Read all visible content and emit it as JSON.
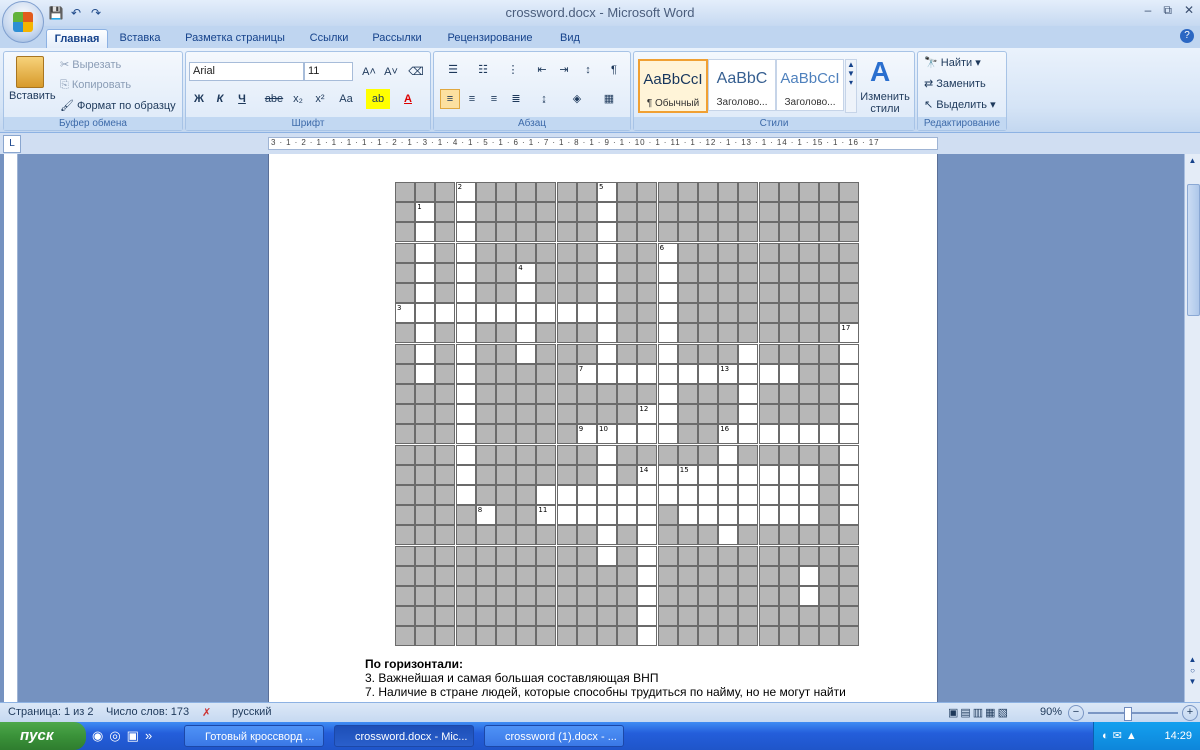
{
  "window": {
    "title": "crossword.docx - Microsoft Word"
  },
  "qat": {
    "save": "💾",
    "undo": "↶",
    "redo": "↷"
  },
  "window_controls": {
    "minimize": "–",
    "restore": "⧉",
    "close": "✕"
  },
  "tabs": [
    "Главная",
    "Вставка",
    "Разметка страницы",
    "Ссылки",
    "Рассылки",
    "Рецензирование",
    "Вид"
  ],
  "help": "?",
  "clipboard": {
    "paste": "Вставить",
    "cut": "Вырезать",
    "copy": "Копировать",
    "format_painter": "Формат по образцу",
    "label": "Буфер обмена"
  },
  "font": {
    "name": "Arial",
    "size": "11",
    "label": "Шрифт",
    "bold": "Ж",
    "italic": "К",
    "underline": "Ч",
    "strike": "abe",
    "sub": "x₂",
    "sup": "x²",
    "case": "Aa",
    "grow": "A˄",
    "shrink": "A˅"
  },
  "paragraph": {
    "label": "Абзац"
  },
  "styles": {
    "label": "Стили",
    "items": [
      {
        "preview": "AaBbCcI",
        "name": "¶ Обычный"
      },
      {
        "preview": "AaBbC",
        "name": "Заголово..."
      },
      {
        "preview": "AaBbCcI",
        "name": "Заголово..."
      }
    ],
    "change": "Изменить стили"
  },
  "editing": {
    "find": "Найти",
    "replace": "Заменить",
    "select": "Выделить",
    "label": "Редактирование"
  },
  "ruler": {
    "ticks": "3 · 1 · 2 · 1 · 1 · 1 · 1 · 1 · 2 · 1 · 3 · 1 · 4 · 1 · 5 · 1 · 6 · 1 · 7 · 1 · 8 · 1 · 9 · 1 · 10 · 1 · 11 · 1 · 12 · 1 · 13 · 1 · 14 · 1 · 15 · 1 · 16 · 17"
  },
  "crossword": {
    "rows": 23,
    "cols": 23,
    "white_cells": [
      [
        1,
        1
      ],
      [
        2,
        1
      ],
      [
        3,
        1
      ],
      [
        4,
        1
      ],
      [
        5,
        1
      ],
      [
        6,
        1
      ],
      [
        7,
        1
      ],
      [
        8,
        1
      ],
      [
        9,
        1
      ],
      [
        0,
        3
      ],
      [
        1,
        3
      ],
      [
        2,
        3
      ],
      [
        3,
        3
      ],
      [
        4,
        3
      ],
      [
        5,
        3
      ],
      [
        6,
        3
      ],
      [
        7,
        3
      ],
      [
        8,
        3
      ],
      [
        9,
        3
      ],
      [
        10,
        3
      ],
      [
        11,
        3
      ],
      [
        12,
        3
      ],
      [
        13,
        3
      ],
      [
        14,
        3
      ],
      [
        15,
        3
      ],
      [
        0,
        10
      ],
      [
        1,
        10
      ],
      [
        2,
        10
      ],
      [
        3,
        10
      ],
      [
        4,
        10
      ],
      [
        5,
        10
      ],
      [
        6,
        10
      ],
      [
        7,
        10
      ],
      [
        8,
        10
      ],
      [
        9,
        10
      ],
      [
        4,
        6
      ],
      [
        5,
        6
      ],
      [
        6,
        6
      ],
      [
        7,
        6
      ],
      [
        8,
        6
      ],
      [
        3,
        13
      ],
      [
        4,
        13
      ],
      [
        5,
        13
      ],
      [
        6,
        13
      ],
      [
        7,
        13
      ],
      [
        8,
        13
      ],
      [
        9,
        13
      ],
      [
        10,
        13
      ],
      [
        11,
        13
      ],
      [
        6,
        0
      ],
      [
        6,
        2
      ],
      [
        6,
        4
      ],
      [
        6,
        5
      ],
      [
        6,
        7
      ],
      [
        6,
        8
      ],
      [
        6,
        9
      ],
      [
        9,
        9
      ],
      [
        9,
        11
      ],
      [
        9,
        12
      ],
      [
        9,
        14
      ],
      [
        9,
        15
      ],
      [
        9,
        16
      ],
      [
        9,
        17
      ],
      [
        9,
        18
      ],
      [
        9,
        19
      ],
      [
        12,
        9
      ],
      [
        12,
        10
      ],
      [
        12,
        11
      ],
      [
        12,
        12
      ],
      [
        12,
        13
      ],
      [
        11,
        12
      ],
      [
        13,
        10
      ],
      [
        14,
        10
      ],
      [
        15,
        10
      ],
      [
        16,
        10
      ],
      [
        17,
        10
      ],
      [
        18,
        10
      ],
      [
        12,
        16
      ],
      [
        13,
        16
      ],
      [
        14,
        16
      ],
      [
        15,
        16
      ],
      [
        16,
        16
      ],
      [
        17,
        16
      ],
      [
        12,
        17
      ],
      [
        12,
        18
      ],
      [
        12,
        19
      ],
      [
        12,
        20
      ],
      [
        12,
        21
      ],
      [
        12,
        22
      ],
      [
        7,
        22
      ],
      [
        8,
        22
      ],
      [
        9,
        22
      ],
      [
        10,
        22
      ],
      [
        11,
        22
      ],
      [
        13,
        22
      ],
      [
        14,
        22
      ],
      [
        15,
        22
      ],
      [
        16,
        22
      ],
      [
        14,
        12
      ],
      [
        14,
        13
      ],
      [
        14,
        14
      ],
      [
        14,
        15
      ],
      [
        14,
        16
      ],
      [
        14,
        17
      ],
      [
        14,
        18
      ],
      [
        14,
        19
      ],
      [
        14,
        20
      ],
      [
        15,
        12
      ],
      [
        15,
        14
      ],
      [
        15,
        15
      ],
      [
        15,
        16
      ],
      [
        15,
        17
      ],
      [
        15,
        18
      ],
      [
        15,
        19
      ],
      [
        15,
        20
      ],
      [
        16,
        12
      ],
      [
        17,
        12
      ],
      [
        18,
        12
      ],
      [
        19,
        12
      ],
      [
        20,
        12
      ],
      [
        21,
        12
      ],
      [
        22,
        12
      ],
      [
        19,
        20
      ],
      [
        20,
        20
      ],
      [
        16,
        7
      ],
      [
        16,
        8
      ],
      [
        16,
        9
      ],
      [
        16,
        11
      ],
      [
        16,
        14
      ],
      [
        16,
        15
      ],
      [
        16,
        17
      ],
      [
        16,
        18
      ],
      [
        16,
        19
      ],
      [
        16,
        20
      ],
      [
        15,
        7
      ],
      [
        15,
        8
      ],
      [
        15,
        9
      ],
      [
        15,
        11
      ],
      [
        15,
        13
      ],
      [
        8,
        17
      ],
      [
        9,
        17
      ],
      [
        10,
        17
      ],
      [
        11,
        17
      ]
    ],
    "numbers": [
      {
        "r": 0,
        "c": 3,
        "n": "2"
      },
      {
        "r": 0,
        "c": 10,
        "n": "5"
      },
      {
        "r": 1,
        "c": 1,
        "n": "1"
      },
      {
        "r": 3,
        "c": 13,
        "n": "6"
      },
      {
        "r": 4,
        "c": 6,
        "n": "4"
      },
      {
        "r": 6,
        "c": 0,
        "n": "3"
      },
      {
        "r": 7,
        "c": 22,
        "n": "17"
      },
      {
        "r": 9,
        "c": 9,
        "n": "7"
      },
      {
        "r": 9,
        "c": 16,
        "n": "13"
      },
      {
        "r": 11,
        "c": 12,
        "n": "12"
      },
      {
        "r": 12,
        "c": 9,
        "n": "9"
      },
      {
        "r": 12,
        "c": 10,
        "n": "10"
      },
      {
        "r": 12,
        "c": 16,
        "n": "16"
      },
      {
        "r": 14,
        "c": 12,
        "n": "14"
      },
      {
        "r": 14,
        "c": 14,
        "n": "15"
      },
      {
        "r": 16,
        "c": 4,
        "n": "8"
      },
      {
        "r": 16,
        "c": 7,
        "n": "11"
      }
    ]
  },
  "clues": {
    "heading": "По горизонтали:",
    "items": [
      "3.  Важнейшая и самая большая составляющая ВНП",
      "7.  Наличие в стране людей, которые способны трудиться по найму, но не могут найти"
    ]
  },
  "status": {
    "page": "Страница: 1 из 2",
    "words": "Число слов: 173",
    "lang": "русский",
    "zoom": "90%"
  },
  "taskbar": {
    "start": "пуск",
    "tasks": [
      "Готовый кроссворд ...",
      "crossword.docx - Mic...",
      "crossword (1).docx - ..."
    ],
    "lang": "RU",
    "time": "14:29"
  }
}
